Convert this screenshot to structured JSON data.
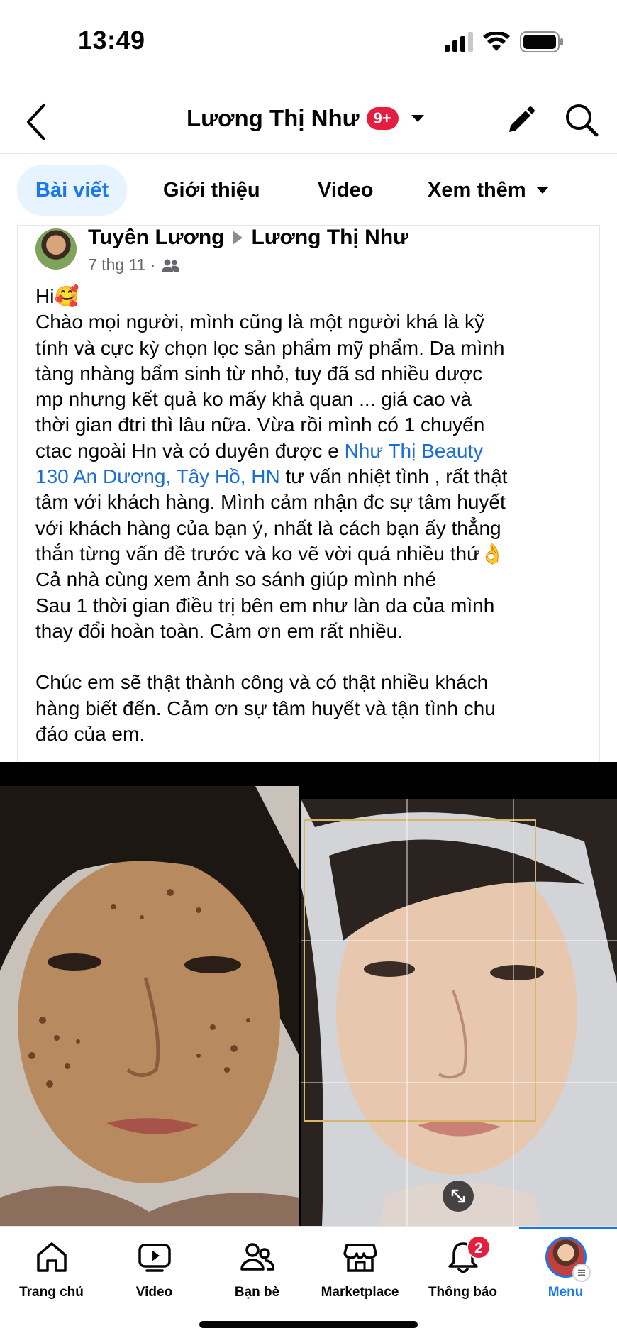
{
  "status_bar": {
    "time": "13:49"
  },
  "header": {
    "title": "Lương Thị Như",
    "badge": "9+"
  },
  "tabs": [
    {
      "label": "Bài viết",
      "active": true
    },
    {
      "label": "Giới thiệu"
    },
    {
      "label": "Video"
    },
    {
      "label": "Xem thêm"
    }
  ],
  "post": {
    "author": "Tuyên Lương",
    "target": "Lương Thị Như",
    "date": "7 thg 11 ·",
    "lines": {
      "l1": "Hi🥰",
      "l2": "Chào mọi người, mình cũng là một người khá là kỹ",
      "l3": "tính và cực kỳ chọn lọc sản phẩm mỹ phẩm. Da mình",
      "l4": "tàng nhàng bẩm sinh từ nhỏ, tuy đã sd nhiều dược",
      "l5": "mp nhưng kết quả ko mấy khả quan ... giá cao và",
      "l6": "thời gian đtri thì lâu nữa. Vừa rồi mình có 1 chuyến",
      "l7": "ctac ngoài Hn và có duyên được e ",
      "l7_link": "Như Thị Beauty",
      "l8_link": "130 An Dương, Tây Hồ, HN",
      "l8": " tư vấn nhiệt tình , rất thật",
      "l9": "tâm với khách hàng. Mình cảm nhận đc sự tâm huyết",
      "l10": "với khách hàng của bạn ý, nhất là cách bạn ấy thẳng",
      "l11": "thắn từng vấn đề trước và ko vẽ vời quá nhiều thứ👌",
      "l12": "Cả nhà cùng xem ảnh so sánh giúp mình nhé",
      "l13": "Sau 1 thời gian điều trị bên em như làn da của mình",
      "l14": "thay đổi hoàn toàn. Cảm ơn em rất nhiều.",
      "l15": "Chúc em sẽ thật thành công và có thật nhiều khách",
      "l16": "hàng biết đến. Cảm ơn sự tâm huyết và tận tình chu",
      "l17": "đáo của em."
    }
  },
  "bottom_nav": {
    "items": [
      {
        "label": "Trang chủ",
        "icon": "home-icon"
      },
      {
        "label": "Video",
        "icon": "video-icon"
      },
      {
        "label": "Bạn bè",
        "icon": "friends-icon"
      },
      {
        "label": "Marketplace",
        "icon": "marketplace-icon"
      },
      {
        "label": "Thông báo",
        "icon": "bell-icon",
        "badge": "2"
      },
      {
        "label": "Menu",
        "icon": "profile-avatar",
        "active": true
      }
    ]
  },
  "colors": {
    "accent": "#1877f2",
    "badge": "#e41e3f",
    "link": "#1a6ed8"
  }
}
